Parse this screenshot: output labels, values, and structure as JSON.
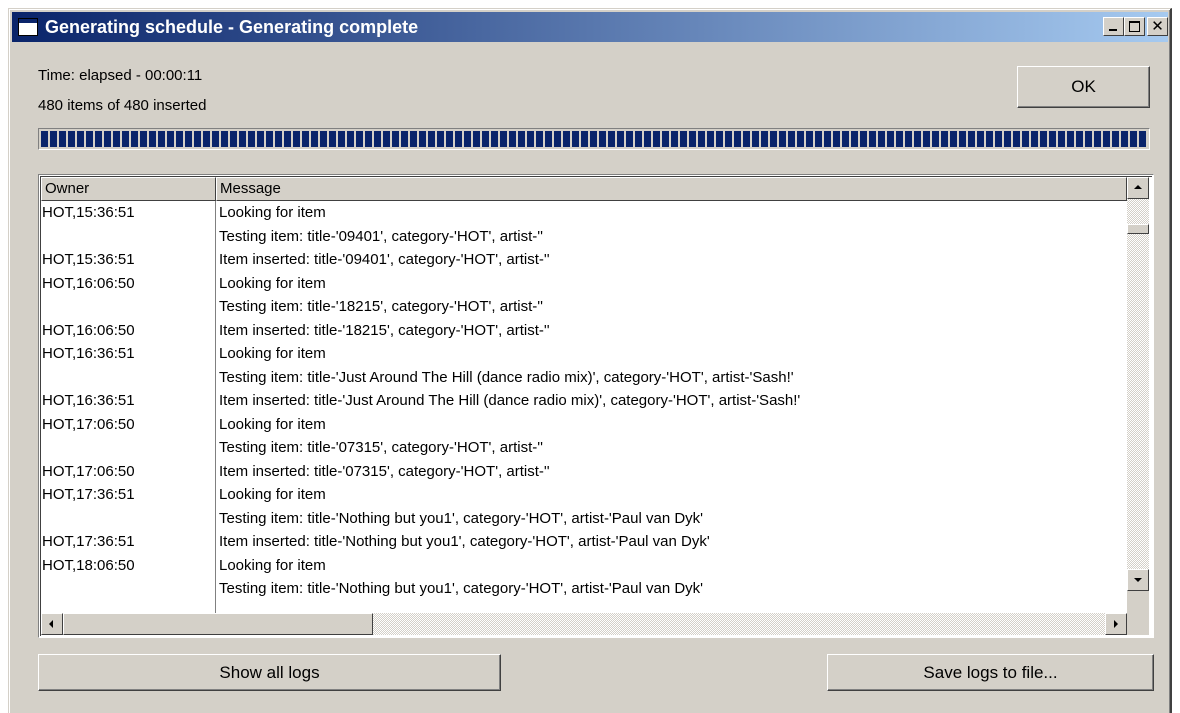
{
  "window": {
    "title": "Generating schedule - Generating complete"
  },
  "status": {
    "time_elapsed": "Time: elapsed - 00:00:11",
    "items_inserted": "480 items of 480 inserted",
    "progress_fraction": 1.0
  },
  "buttons": {
    "ok": "OK",
    "show_all_logs": "Show all logs",
    "save_logs": "Save logs to file..."
  },
  "log": {
    "columns": [
      "Owner",
      "Message"
    ],
    "rows": [
      {
        "owner": "HOT,15:36:51",
        "message": "Looking for item"
      },
      {
        "owner": "",
        "message": "Testing item: title-'09401', category-'HOT', artist-''"
      },
      {
        "owner": "HOT,15:36:51",
        "message": "Item inserted: title-'09401', category-'HOT', artist-''"
      },
      {
        "owner": "HOT,16:06:50",
        "message": "Looking for item"
      },
      {
        "owner": "",
        "message": "Testing item: title-'18215', category-'HOT', artist-''"
      },
      {
        "owner": "HOT,16:06:50",
        "message": "Item inserted: title-'18215', category-'HOT', artist-''"
      },
      {
        "owner": "HOT,16:36:51",
        "message": "Looking for item"
      },
      {
        "owner": "",
        "message": "Testing item: title-'Just Around The Hill (dance radio mix)', category-'HOT', artist-'Sash!'"
      },
      {
        "owner": "HOT,16:36:51",
        "message": "Item inserted: title-'Just Around The Hill (dance radio mix)', category-'HOT', artist-'Sash!'"
      },
      {
        "owner": "HOT,17:06:50",
        "message": "Looking for item"
      },
      {
        "owner": "",
        "message": "Testing item: title-'07315', category-'HOT', artist-''"
      },
      {
        "owner": "HOT,17:06:50",
        "message": "Item inserted: title-'07315', category-'HOT', artist-''"
      },
      {
        "owner": "HOT,17:36:51",
        "message": "Looking for item"
      },
      {
        "owner": "",
        "message": "Testing item: title-'Nothing but you1', category-'HOT', artist-'Paul van Dyk'"
      },
      {
        "owner": "HOT,17:36:51",
        "message": "Item inserted: title-'Nothing but you1', category-'HOT', artist-'Paul van Dyk'"
      },
      {
        "owner": "HOT,18:06:50",
        "message": "Looking for item"
      },
      {
        "owner": "",
        "message": "Testing item: title-'Nothing but you1', category-'HOT', artist-'Paul van Dyk'"
      }
    ]
  },
  "icons": {
    "window_icon": "window-icon",
    "minimize": "minimize-icon",
    "maximize": "maximize-icon",
    "close": "close-icon"
  },
  "colors": {
    "titlebar_start": "#0a246a",
    "titlebar_end": "#a6caf0",
    "progress": "#0a246a",
    "face": "#d4d0c8"
  }
}
